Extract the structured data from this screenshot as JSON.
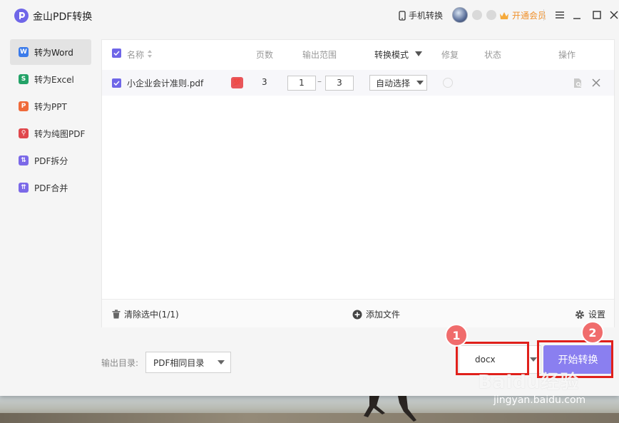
{
  "app": {
    "title": "金山PDF转换"
  },
  "titlebar": {
    "mobile_label": "手机转换",
    "vip_label": "开通会员"
  },
  "sidebar": {
    "items": [
      {
        "label": "转为Word",
        "icon": "word-icon",
        "color": "#3b7bea",
        "glyph": "W"
      },
      {
        "label": "转为Excel",
        "icon": "excel-icon",
        "color": "#23a267",
        "glyph": "S"
      },
      {
        "label": "转为PPT",
        "icon": "ppt-icon",
        "color": "#ef6a3a",
        "glyph": "P"
      },
      {
        "label": "转为纯图PDF",
        "icon": "image-pdf-icon",
        "color": "#e0474c",
        "glyph": "⚲"
      },
      {
        "label": "PDF拆分",
        "icon": "split-icon",
        "color": "#7b69e8",
        "glyph": "⇅"
      },
      {
        "label": "PDF合并",
        "icon": "merge-icon",
        "color": "#7b69e8",
        "glyph": "⇈"
      }
    ]
  },
  "table": {
    "headers": {
      "name": "名称",
      "pages": "页数",
      "range": "输出范围",
      "mode": "转换模式",
      "repair": "修复",
      "status": "状态",
      "action": "操作"
    },
    "rows": [
      {
        "name": "小企业会计准则.pdf",
        "badge": "💯",
        "pages": "3",
        "range_from": "1",
        "range_to": "3",
        "mode": "自动选择"
      }
    ],
    "range_dash": "–"
  },
  "footer": {
    "clear_label": "清除选中(1/1)",
    "add_label": "添加文件",
    "settings_label": "设置"
  },
  "output": {
    "label": "输出目录:",
    "dir_value": "PDF相同目录",
    "format_value": "docx",
    "start_label": "开始转换"
  },
  "annotations": {
    "marker1": "1",
    "marker2": "2",
    "color": "#e0201b"
  },
  "watermark": {
    "main": "Baidu经验",
    "url": "jingyan.baidu.com"
  }
}
